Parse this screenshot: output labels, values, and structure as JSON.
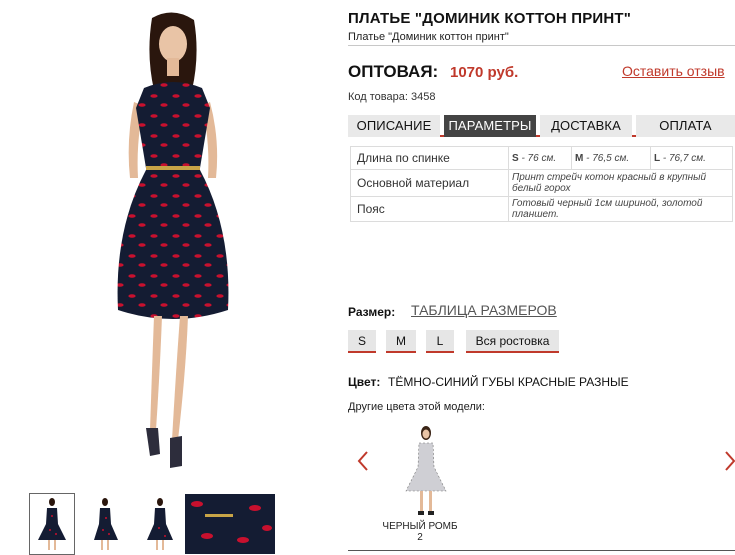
{
  "product": {
    "title": "ПЛАТЬЕ \"ДОМИНИК КОТТОН ПРИНТ\"",
    "subtitle": "Платье \"Доминик коттон принт\"",
    "price_label": "ОПТОВАЯ:",
    "price_value": "1070 руб.",
    "review_link": "Оставить отзыв",
    "sku": "Код товара: 3458"
  },
  "tabs": [
    {
      "label": "ОПИСАНИЕ",
      "active": false
    },
    {
      "label": "ПАРАМЕТРЫ",
      "active": true
    },
    {
      "label": "ДОСТАВКА",
      "active": false
    },
    {
      "label": "ОПЛАТА",
      "active": false
    }
  ],
  "params": {
    "length": {
      "name": "Длина по спинке",
      "values": [
        {
          "size": "S",
          "value": " - 76 см."
        },
        {
          "size": "M",
          "value": " - 76,5 см."
        },
        {
          "size": "L",
          "value": " - 76,7 см."
        }
      ]
    },
    "material": {
      "name": "Основной материал",
      "value": "Принт стрейч котон красный в крупный белый горох"
    },
    "belt": {
      "name": "Пояс",
      "value": "Готовый черный 1см шириной, золотой планшет."
    }
  },
  "size": {
    "label": "Размер:",
    "table_link": "ТАБЛИЦА РАЗМЕРОВ",
    "options": [
      "S",
      "M",
      "L",
      "Вся ростовка"
    ]
  },
  "color": {
    "label": "Цвет:",
    "value": "ТЁМНО-СИНИЙ ГУБЫ КРАСНЫЕ РАЗНЫЕ",
    "other_colors_label": "Другие цвета этой модели:",
    "variant_name": "ЧЕРНЫЙ РОМБ",
    "variant_number": "2"
  },
  "icons": {
    "prev": "chevron-left-icon",
    "next": "chevron-right-icon"
  },
  "colors": {
    "accent": "#c0392b",
    "active_tab": "#444444",
    "tab": "#e9e9e9",
    "dress": "#141c33",
    "lips": "#c8102e"
  }
}
